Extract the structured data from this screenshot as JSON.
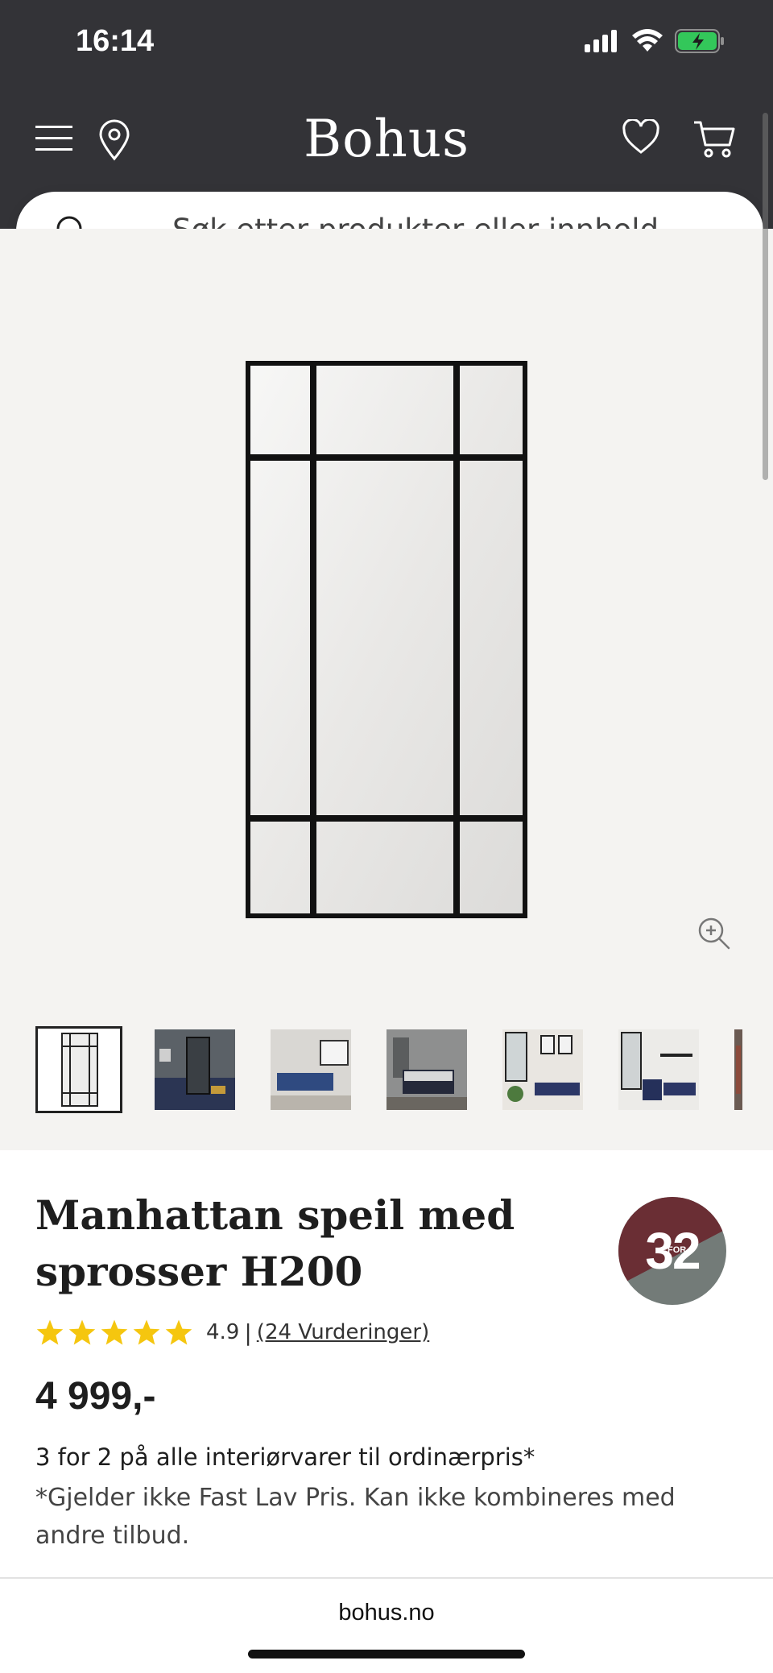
{
  "status_bar": {
    "time": "16:14"
  },
  "header": {
    "brand": "Bohus"
  },
  "search": {
    "placeholder": "Søk etter produkter eller innhold..."
  },
  "gallery": {
    "thumbnails": [
      "mirror-product",
      "mirror-in-room",
      "living-room-sofa",
      "bedroom",
      "room-with-plants",
      "room-with-shelf",
      "room-partial"
    ]
  },
  "product": {
    "title_line1": "Manhattan speil med",
    "title_line2": "sprosser H200",
    "badge": {
      "main": "32",
      "small": "FOR",
      "color_top": "#6a2e34",
      "color_bottom": "#737b78"
    },
    "rating": {
      "value": "4.9",
      "separator": "|",
      "reviews": "(24 Vurderinger)",
      "stars": 5
    },
    "price": "4 999,-",
    "promo_title": "3 for 2 på alle interiørvarer til ordinærpris*",
    "promo_note": "*Gjelder ikke Fast Lav Pris. Kan ikke kombineres med andre tilbud."
  },
  "footer": {
    "url": "bohus.no"
  },
  "colors": {
    "header_bg": "#333337",
    "star": "#f5c60f"
  }
}
